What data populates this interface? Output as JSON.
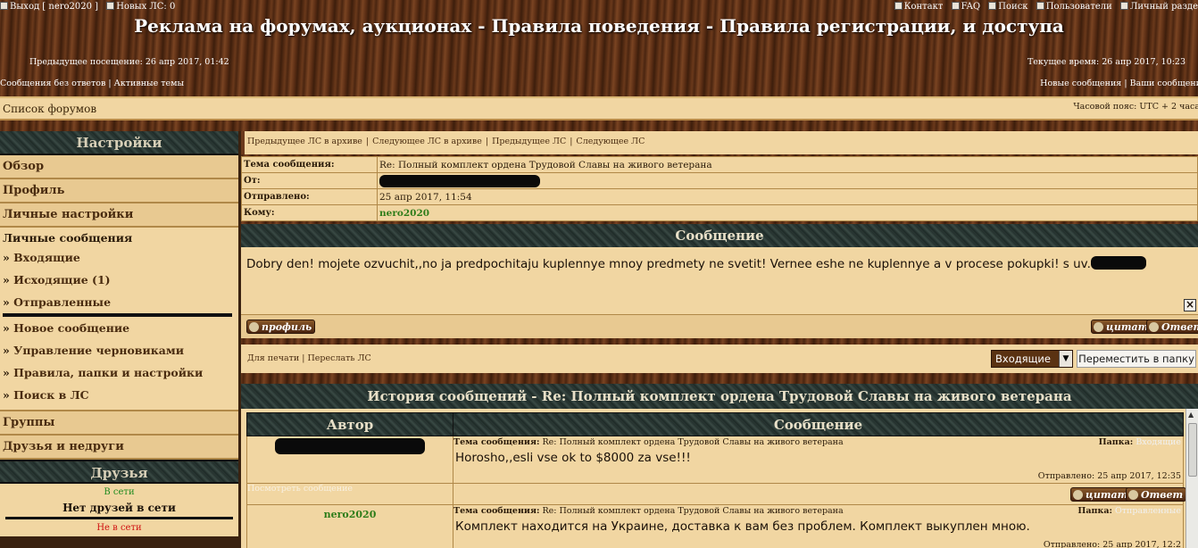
{
  "header": {
    "logout": "Выход [ nero2020 ]",
    "new_pm": "Новых ЛС: 0",
    "contact": "Контакт",
    "faq": "FAQ",
    "search": "Поиск",
    "users": "Пользователи",
    "personal": "Личный разде",
    "site_title": "Реклама на форумах, аукционах - Правила поведения - Правила регистрации, и доступа",
    "prev_visit": "Предыдущее посещение: 26 апр 2017, 01:42",
    "current_time": "Текущее время: 26 апр 2017, 10:23",
    "unanswered": "Сообщения без ответов",
    "active_topics": "Активные темы",
    "new_posts": "Новые сообщения",
    "your_posts": "Ваши сообщени"
  },
  "forumbar": {
    "forum_list": "Список форумов",
    "timezone": "Часовой пояс: UTC + 2 часа"
  },
  "sidebar": {
    "settings_header": "Настройки",
    "overview": "Обзор",
    "profile": "Профиль",
    "personal_settings": "Личные настройки",
    "pm_title": "Личные сообщения",
    "pm_items": [
      "Входящие",
      "Исходящие (1)",
      "Отправленные"
    ],
    "pm_actions": [
      "Новое сообщение",
      "Управление черновиками",
      "Правила, папки и настройки",
      "Поиск в ЛС"
    ],
    "groups": "Группы",
    "friends_foes": "Друзья и недруги",
    "friends_header": "Друзья",
    "online": "В сети",
    "no_friends_online": "Нет друзей в сети",
    "offline": "Не в сети"
  },
  "nav": {
    "prev_archive": "Предыдущее ЛС в архиве",
    "next_archive": "Следующее ЛС в архиве",
    "prev_pm": "Предыдущее ЛС",
    "next_pm": "Следующее ЛС"
  },
  "message": {
    "subject_label": "Тема сообщения:",
    "subject": "Re: Полный комплект ордена Трудовой Славы на живого ветерана",
    "from_label": "От:",
    "sent_label": "Отправлено:",
    "sent": "25 апр 2017, 11:54",
    "to_label": "Кому:",
    "to": "nero2020",
    "header": "Сообщение",
    "body": "Dobry den! mojete ozvuchit,,no ja predpochitaju kuplennye mnoy predmety ne svetit! Vernee eshe ne kuplennye a v procese pokupki! s uv.",
    "profile_btn": "профиль",
    "quote_btn": "цитата",
    "reply_btn": "Ответ"
  },
  "actions": {
    "print": "Для печати",
    "forward": "Переслать ЛС",
    "folder": "Входящие",
    "move_btn": "Переместить в папку"
  },
  "history": {
    "header": "История сообщений - Re: Полный комплект ордена Трудовой Славы на живого ветерана",
    "col_author": "Автор",
    "col_message": "Сообщение",
    "subject_label": "Тема сообщения:",
    "folder_label": "Папка:",
    "entries": [
      {
        "author": "",
        "subject": "Re: Полный комплект ордена Трудовой Славы на живого ветерана",
        "folder": "Входящие",
        "text": "Horosho,,esli vse ok to $8000 za vse!!!",
        "sent": "Отправлено: 25 апр 2017, 12:35",
        "view_link": "Посмотреть сообщение"
      },
      {
        "author": "nero2020",
        "subject": "Re: Полный комплект ордена Трудовой Славы на живого ветерана",
        "folder": "Отправленные",
        "text": "Комплект находится на Украине, доставка к вам без проблем. Комплект выкуплен мною.",
        "sent": "Отправлено: 25 апр 2017, 12:2"
      }
    ]
  },
  "colors": {
    "cream": "#f1d6a2",
    "link_green": "#2e7d1a",
    "online_green": "#1e8a1e",
    "offline_red": "#d01010"
  }
}
